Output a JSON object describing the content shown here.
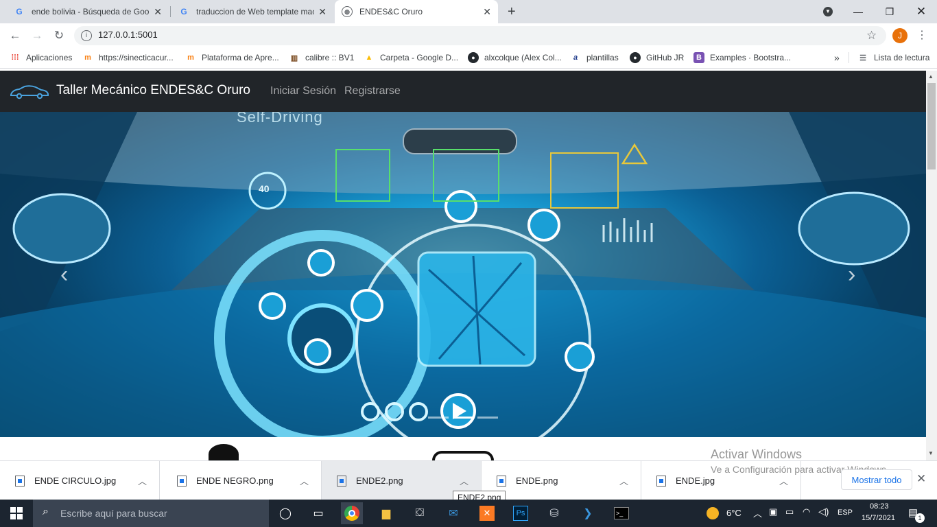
{
  "browser": {
    "tabs": [
      {
        "title": "ende bolivia - Búsqueda de Goog",
        "favicon": "google-icon"
      },
      {
        "title": "traduccion de Web template mac",
        "favicon": "google-icon"
      },
      {
        "title": "ENDES&C Oruro",
        "favicon": "globe-icon",
        "active": true
      }
    ],
    "url": "127.0.0.1:5001",
    "profile_initial": "J",
    "bookmarks": [
      {
        "label": "Aplicaciones",
        "icon": "apps-grid-icon"
      },
      {
        "label": "https://sinecticacur...",
        "icon": "moodle-icon"
      },
      {
        "label": "Plataforma de Apre...",
        "icon": "moodle-icon"
      },
      {
        "label": "calibre :: BV1",
        "icon": "calibre-icon"
      },
      {
        "label": "Carpeta - Google D...",
        "icon": "google-drive-icon"
      },
      {
        "label": "alxcolque (Alex Col...",
        "icon": "github-icon"
      },
      {
        "label": "plantillas",
        "icon": "plantillas-icon"
      },
      {
        "label": "GitHub JR",
        "icon": "github-icon"
      },
      {
        "label": "Examples · Bootstra...",
        "icon": "bootstrap-icon"
      }
    ],
    "reading_list": "Lista de lectura"
  },
  "site": {
    "brand": "Taller Mecánico ENDES&C Oruro",
    "nav": [
      "Iniciar Sesión",
      "Registrarse"
    ],
    "hero": {
      "overlay_text": "Self-Driving",
      "speed": "40"
    }
  },
  "watermark": {
    "title": "Activar Windows",
    "subtitle": "Ve a Configuración para activar Windows."
  },
  "downloads": {
    "files": [
      "ENDE CIRCULO.jpg",
      "ENDE NEGRO.png",
      "ENDE2.png",
      "ENDE.png",
      "ENDE.jpg"
    ],
    "tooltip": "ENDE2.png",
    "show_all": "Mostrar todo"
  },
  "taskbar": {
    "search_placeholder": "Escribe aquí para buscar",
    "weather": "6°C",
    "language": "ESP",
    "time": "08:23",
    "date": "15/7/2021",
    "notifications": "1"
  },
  "colors": {
    "navbar": "#212529",
    "accent": "#1a73e8",
    "profile": "#e8710a"
  }
}
